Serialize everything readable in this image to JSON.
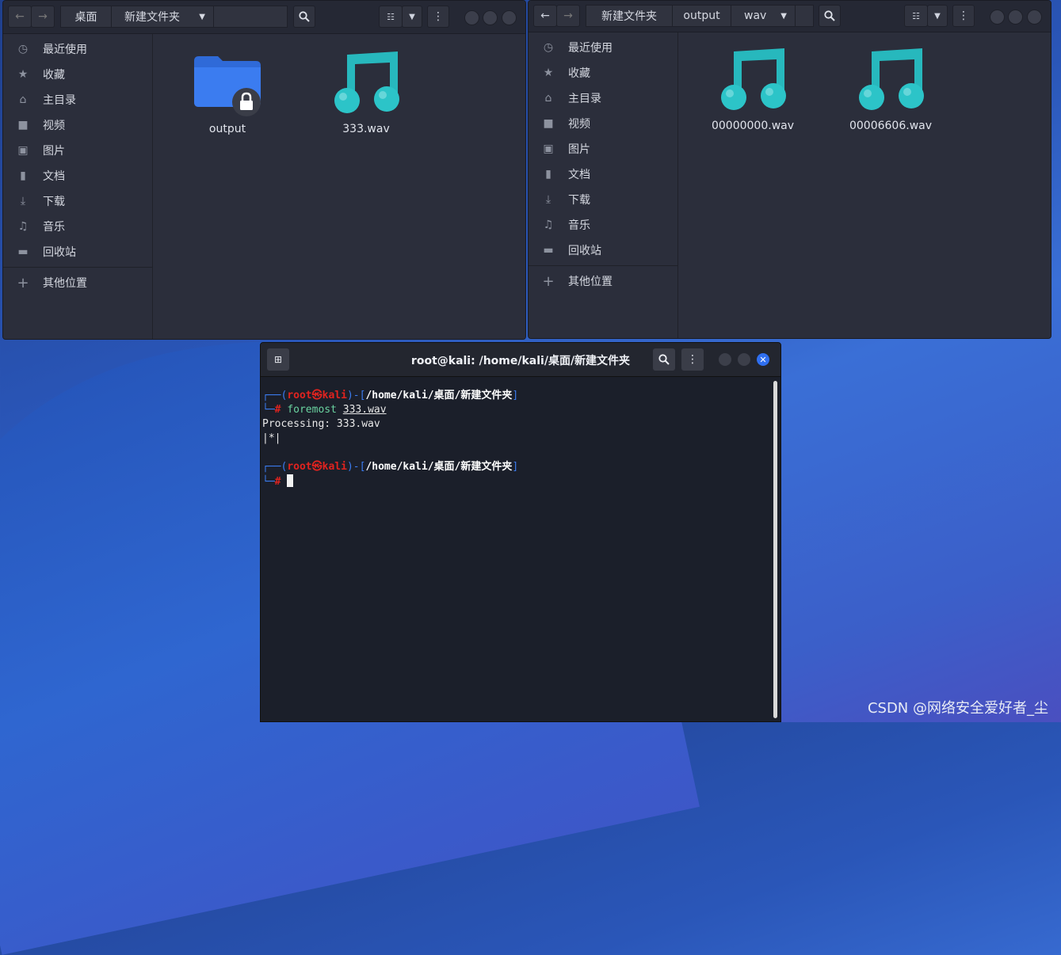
{
  "window_left": {
    "crumbs": [
      "桌面",
      "新建文件夹"
    ],
    "sidebar": [
      "最近使用",
      "收藏",
      "主目录",
      "视频",
      "图片",
      "文档",
      "下载",
      "音乐",
      "回收站"
    ],
    "other_places": "其他位置",
    "files": [
      {
        "name": "output",
        "type": "locked-folder"
      },
      {
        "name": "333.wav",
        "type": "audio"
      }
    ]
  },
  "window_right": {
    "crumbs": [
      "新建文件夹",
      "output",
      "wav"
    ],
    "sidebar": [
      "最近使用",
      "收藏",
      "主目录",
      "视频",
      "图片",
      "文档",
      "下载",
      "音乐",
      "回收站"
    ],
    "other_places": "其他位置",
    "files": [
      {
        "name": "00000000.wav",
        "type": "audio"
      },
      {
        "name": "00006606.wav",
        "type": "audio"
      }
    ]
  },
  "terminal": {
    "title": "root@kali: /home/kali/桌面/新建文件夹",
    "prompt_user": "root",
    "prompt_at": "㉿",
    "prompt_host": "kali",
    "prompt_path": "/home/kali/桌面/新建文件夹",
    "command": "foremost",
    "command_arg": "333.wav",
    "output_line1": "Processing: 333.wav",
    "output_line2": "|*|"
  },
  "watermark": "CSDN @网络安全爱好者_尘",
  "colors": {
    "folder": "#3b7cf0",
    "audio_icon": "#2cc4c8",
    "close_button": "#2f6ff0"
  }
}
